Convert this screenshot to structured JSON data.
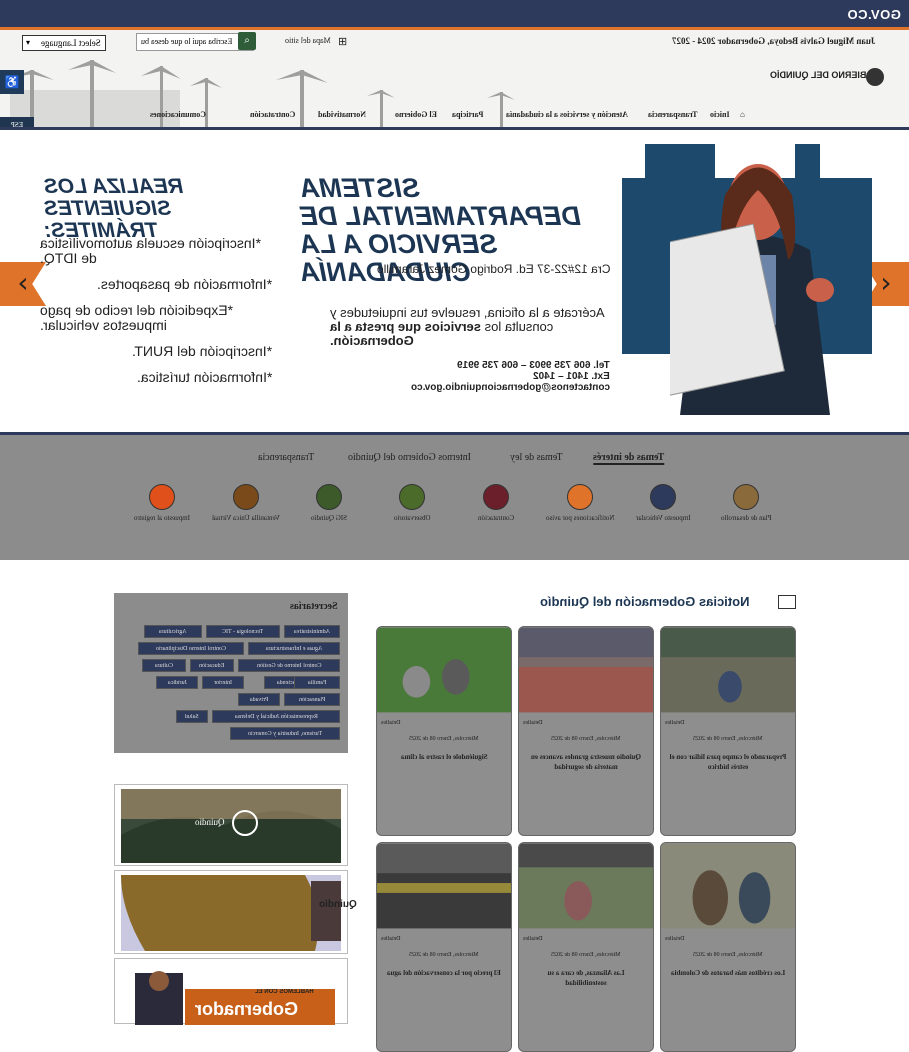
{
  "gov_logo": "GOV.CO",
  "header": {
    "governor": "Juan Miguel Galvis Bedoya, Gobernador 2024 - 2027",
    "language_select": "Select Language",
    "search_placeholder": "Escriba aquí lo que desea bu",
    "sitemap": "Mapa del sitio",
    "brand": "GOBIERNO DEL QUINDÍO",
    "espanol_label": "ESP",
    "nav": [
      "Inicio",
      "Transparencia",
      "Atención y servicios a la ciudadanía",
      "Participa",
      "El Gobierno",
      "Normatividad",
      "Contratación",
      "Comunicaciones"
    ]
  },
  "hero": {
    "left_title": "Realiza los siguientes trámites:",
    "tramites": [
      "*Inscripción escuela automovilística de IDTQ.",
      "*Información de pasaportes.",
      "*Expedición del recibo de pago impuestos vehicular.",
      "*Inscripción del RUNT.",
      "*Información turística."
    ],
    "system_name": "Sistema Departamental de Servicio a la Ciudadanía",
    "address": "Cra 12#22-37 Ed. Rodrigo Gómez Jaramillo",
    "intro_normal": "Acércate a la oficina, resuelve tus inquietudes y consulta los ",
    "intro_bold": "servicios que presta a la Gobernación.",
    "phone": "Tel. 606 735 9903 – 606 735 9919",
    "ext": "Ext. 1401 – 1402",
    "email": "contactenos@gobernacionquindio.gov.co",
    "prev_arrow": "‹",
    "next_arrow": "›"
  },
  "tabs": [
    "Temas de interés",
    "Temas de ley",
    "Internos Gobierno del Quindío",
    "Transparencia"
  ],
  "quick_links": [
    {
      "label": "Plan de desarrollo",
      "color": "#8a6a3a"
    },
    {
      "label": "Impuesto Vehicular",
      "color": "#2e3a5c"
    },
    {
      "label": "Notificaciones por aviso",
      "color": "#e0732a"
    },
    {
      "label": "Contratación",
      "color": "#6b1f2a"
    },
    {
      "label": "Observatorio",
      "color": "#4a6b2a"
    },
    {
      "label": "SIG Quindío",
      "color": "#3d5a2a"
    },
    {
      "label": "Ventanilla Única Virtual",
      "color": "#7a4a1a"
    },
    {
      "label": "Impuesto al registro",
      "color": "#e0501a"
    }
  ],
  "secretarias": {
    "title": "Secretarías",
    "items": [
      "Administrativa",
      "Tecnología - TIC",
      "Agricultura",
      "Aguas e Infraestructura",
      "Control Interno Disciplinario",
      "Control Interno de Gestión",
      "Educación",
      "Cultura",
      "Hacienda",
      "Familia",
      "Interior",
      "Jurídica",
      "Planeación",
      "Privada",
      "Representación Judicial y Defensa",
      "Salud",
      "Turismo, Industria y Comercio"
    ]
  },
  "banners": [
    "Quindío",
    "Quindío",
    "Gobernador"
  ],
  "banner_subtitle": "HABLEMOS CON EL",
  "news": {
    "title": "Noticias Gobernación del Quindío",
    "detail_label": "Detalles",
    "items": [
      {
        "date": "Miércoles, Enero 08 de 2025",
        "title": "Preparando el campo para lidiar con el estrés hídrico"
      },
      {
        "date": "Miércoles, Enero 08 de 2025",
        "title": "Quindío muestra grandes avances en materia de seguridad"
      },
      {
        "date": "Miércoles, Enero 08 de 2025",
        "title": "Siguiéndole el rastro al clima"
      },
      {
        "date": "Miércoles, Enero 08 de 2025",
        "title": "Los créditos más baratos de Colombia"
      },
      {
        "date": "Miércoles, Enero 08 de 2025",
        "title": "Las Alianzas, de cara a su sostenibilidad"
      },
      {
        "date": "Miércoles, Enero 08 de 2025",
        "title": "El precio por la conservación del agua"
      }
    ]
  }
}
